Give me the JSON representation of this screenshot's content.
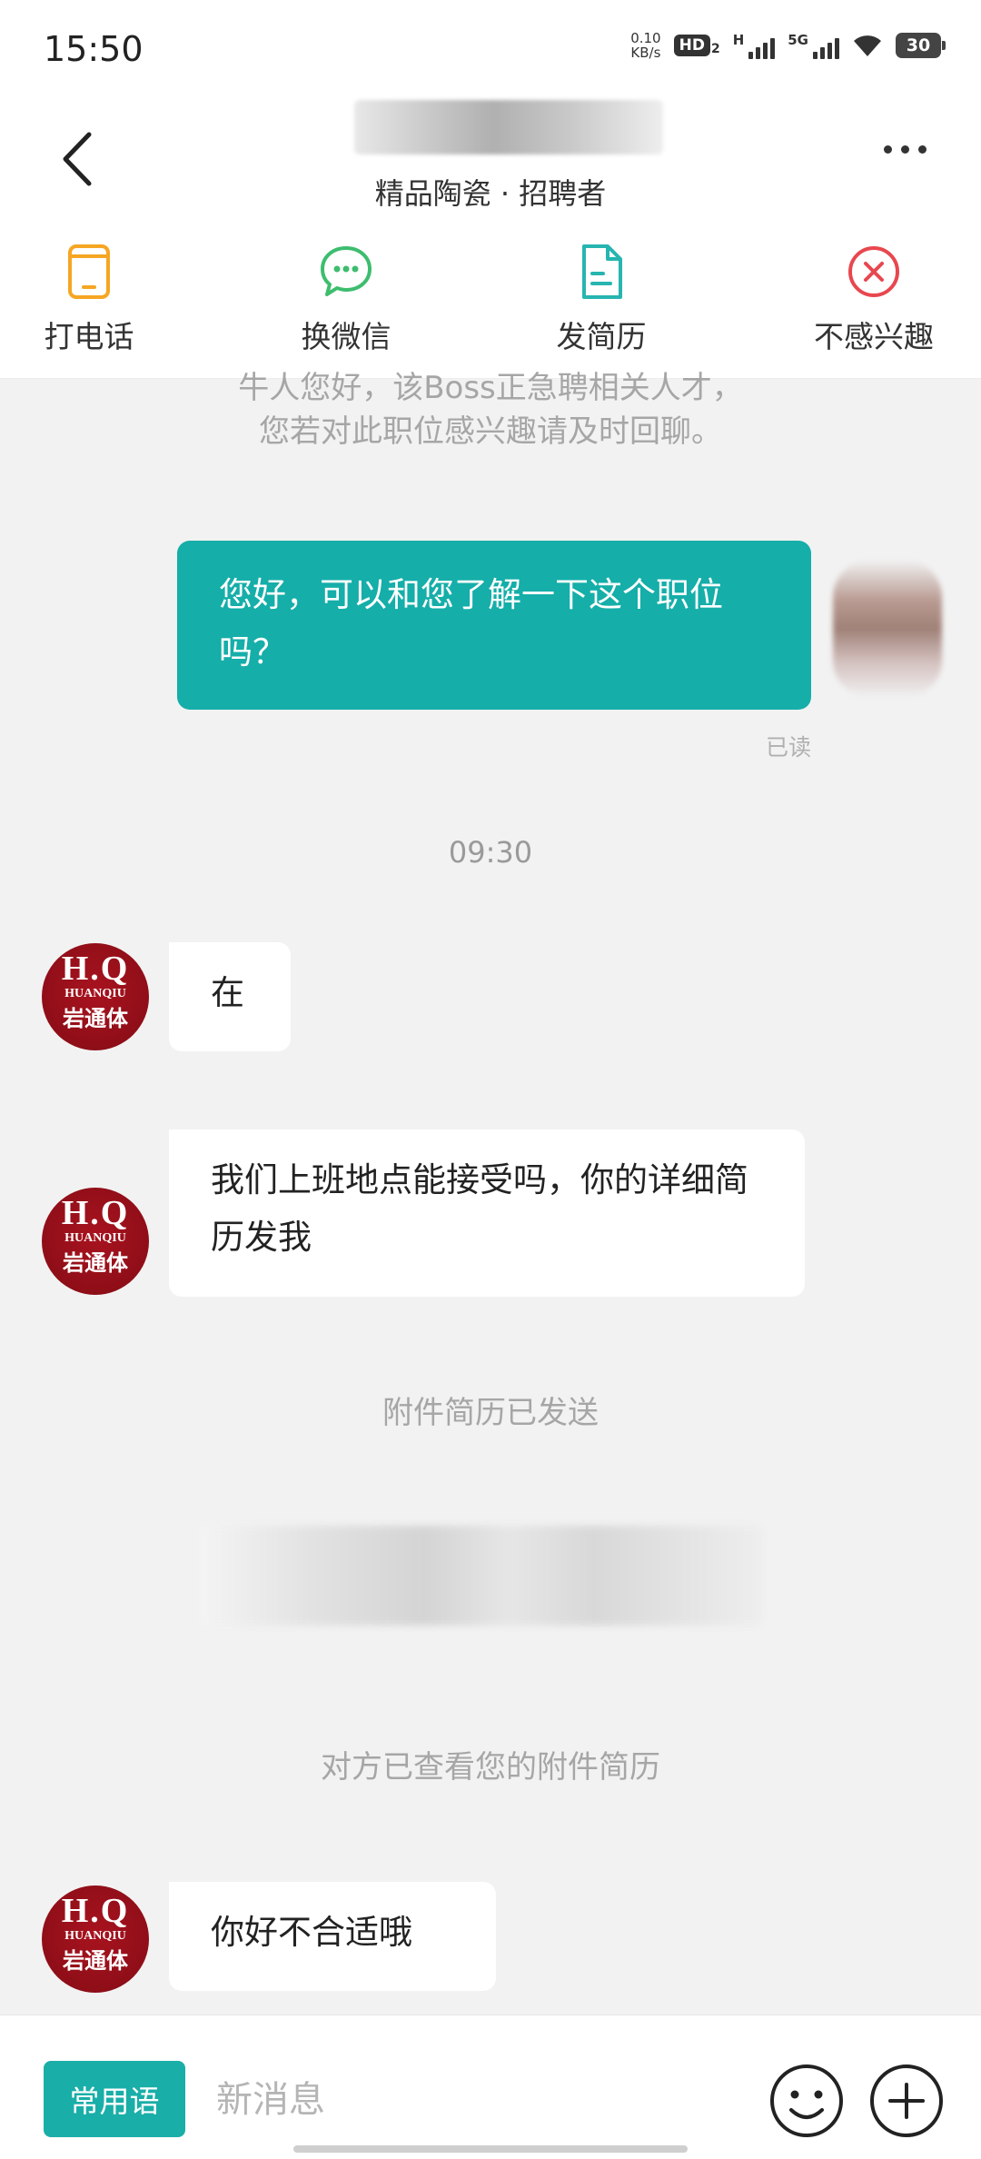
{
  "status": {
    "time": "15:50",
    "net_speed_value": "0.10",
    "net_speed_unit": "KB/s",
    "hd_badge": "HD",
    "hd_badge_sub": "2",
    "signal1_label": "H",
    "signal2_label": "5G",
    "battery": "30"
  },
  "header": {
    "subtitle": "精品陶瓷 · 招聘者"
  },
  "actions": [
    {
      "label": "打电话",
      "icon": "phone-icon"
    },
    {
      "label": "换微信",
      "icon": "wechat-icon"
    },
    {
      "label": "发简历",
      "icon": "resume-icon"
    },
    {
      "label": "不感兴趣",
      "icon": "not-interested-icon"
    }
  ],
  "chat": {
    "system_top_line1": "牛人您好，该Boss正急聘相关人才，",
    "system_top_line2": "您若对此职位感兴趣请及时回聊。",
    "my_message": "您好，可以和您了解一下这个职位吗？",
    "read_status": "已读",
    "time_separator": "09:30",
    "avatar_text_top": "H.Q",
    "avatar_text_mid": "HUANQIU",
    "avatar_text_bottom": "岩通体",
    "recruiter_msg_1": "在",
    "recruiter_msg_2": "我们上班地点能接受吗，你的详细简历发我",
    "notice_resume_sent": "附件简历已发送",
    "notice_viewed": "对方已查看您的附件简历",
    "recruiter_msg_3": "你好不合适哦"
  },
  "input": {
    "phrases_label": "常用语",
    "placeholder": "新消息"
  },
  "colors": {
    "accent": "#15aea9",
    "orange_icon": "#f5a623",
    "green_icon": "#3dbd6e",
    "teal_icon": "#27b5b0",
    "red_icon": "#e8474f",
    "avatar_red": "#a8131f"
  }
}
